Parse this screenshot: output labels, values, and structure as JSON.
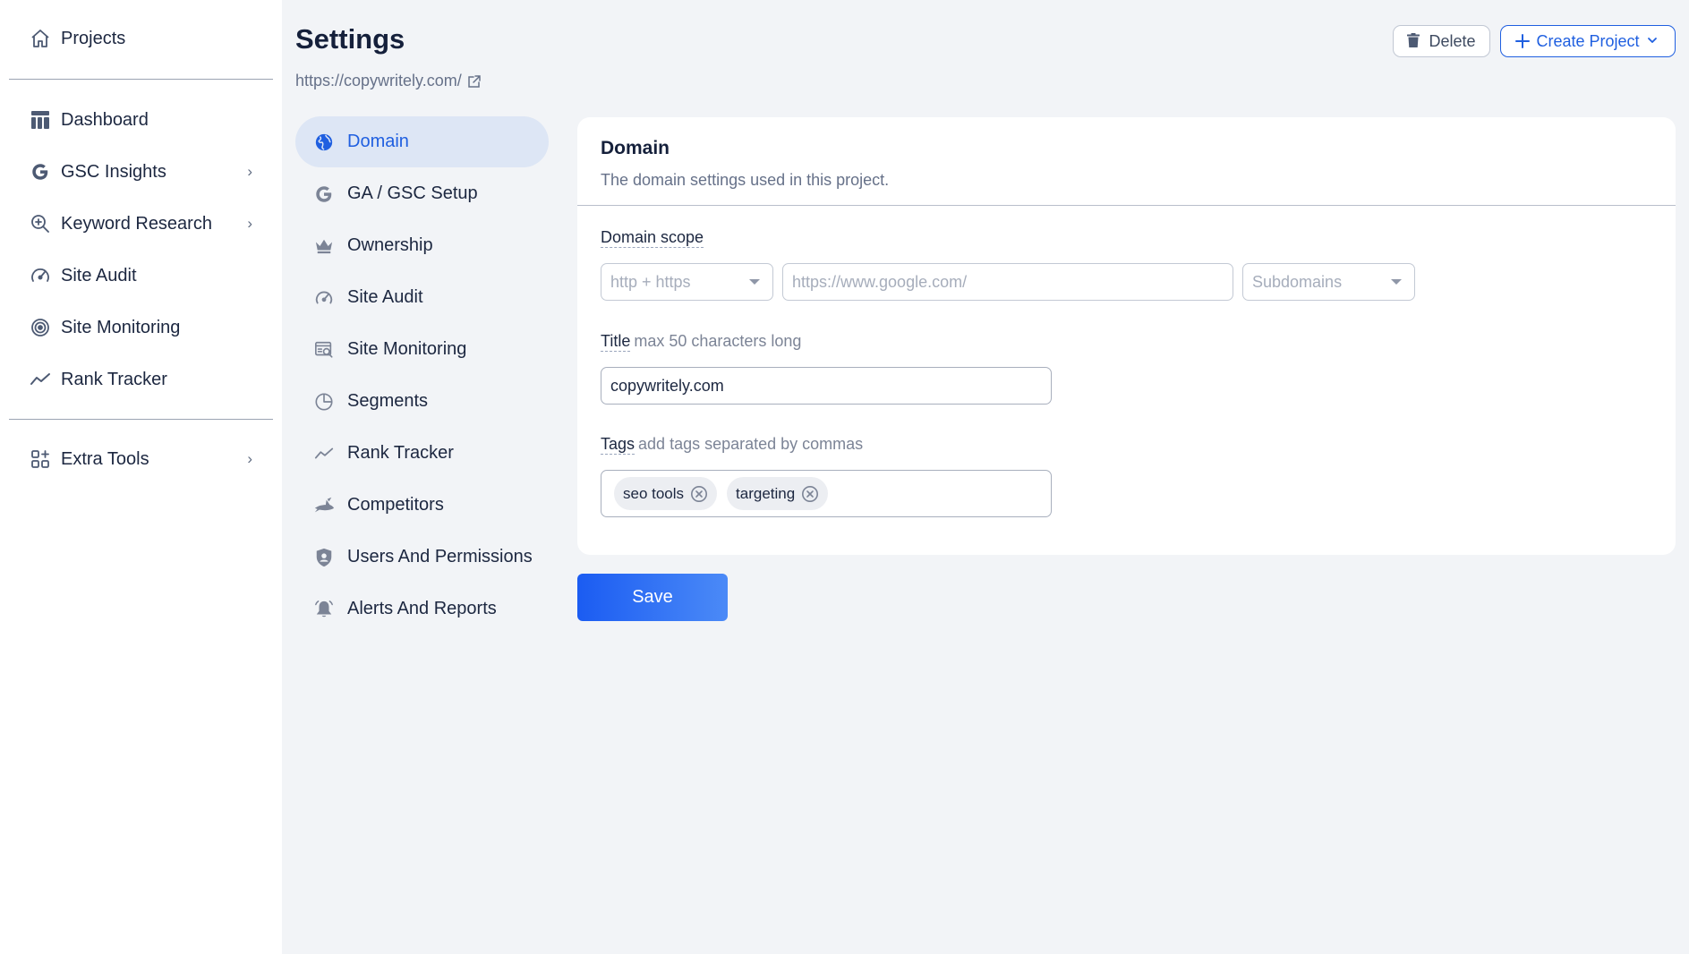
{
  "sidebar": {
    "projects": {
      "label": "Projects",
      "icon": "home-icon"
    },
    "items": [
      {
        "label": "Dashboard",
        "icon": "dashboard-icon",
        "has_submenu": false
      },
      {
        "label": "GSC Insights",
        "icon": "google-icon",
        "has_submenu": true
      },
      {
        "label": "Keyword Research",
        "icon": "keyword-search-icon",
        "has_submenu": true
      },
      {
        "label": "Site Audit",
        "icon": "gauge-icon",
        "has_submenu": false
      },
      {
        "label": "Site Monitoring",
        "icon": "monitoring-icon",
        "has_submenu": false
      },
      {
        "label": "Rank Tracker",
        "icon": "trend-icon",
        "has_submenu": false
      }
    ],
    "extra": {
      "label": "Extra Tools",
      "icon": "grid-plus-icon",
      "has_submenu": true
    },
    "chevron": "›"
  },
  "header": {
    "title": "Settings",
    "url": "https://copywritely.com/",
    "delete_label": "Delete",
    "create_label": "Create Project"
  },
  "settings_nav": [
    {
      "label": "Domain",
      "icon": "globe-icon",
      "active": true
    },
    {
      "label": "GA / GSC Setup",
      "icon": "google-icon",
      "active": false
    },
    {
      "label": "Ownership",
      "icon": "crown-icon",
      "active": false
    },
    {
      "label": "Site Audit",
      "icon": "gauge-icon",
      "active": false
    },
    {
      "label": "Site Monitoring",
      "icon": "monitor-search-icon",
      "active": false
    },
    {
      "label": "Segments",
      "icon": "pie-icon",
      "active": false
    },
    {
      "label": "Rank Tracker",
      "icon": "trend-icon",
      "active": false
    },
    {
      "label": "Competitors",
      "icon": "shark-icon",
      "active": false
    },
    {
      "label": "Users And Permissions",
      "icon": "shield-user-icon",
      "active": false
    },
    {
      "label": "Alerts And Reports",
      "icon": "bell-icon",
      "active": false
    }
  ],
  "domain_card": {
    "title": "Domain",
    "subtitle": "The domain settings used in this project.",
    "scope": {
      "label": "Domain scope",
      "protocol": "http + https",
      "url_placeholder": "https://www.google.com/",
      "subdomains": "Subdomains"
    },
    "title_field": {
      "label": "Title",
      "hint": "max 50 characters long",
      "value": "copywritely.com"
    },
    "tags_field": {
      "label": "Tags",
      "hint": "add tags separated by commas",
      "tags": [
        "seo tools",
        "targeting"
      ]
    }
  },
  "save_label": "Save",
  "colors": {
    "accent": "#1f5fe0",
    "active_nav_bg": "#dde6f5",
    "page_bg": "#f2f4f7"
  }
}
